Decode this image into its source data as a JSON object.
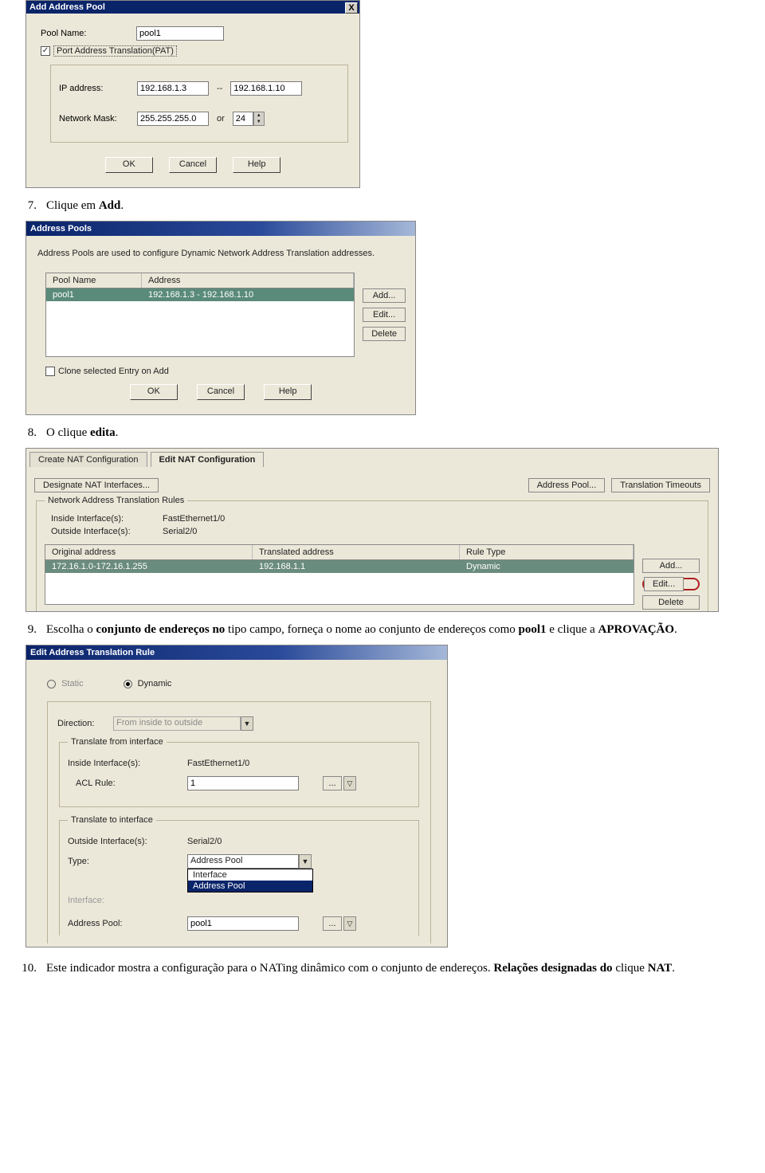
{
  "dlg1": {
    "title": "Add Address Pool",
    "labels": {
      "pool_name": "Pool Name:",
      "pat": "Port Address Translation(PAT)",
      "ip": "IP address:",
      "dash": "--",
      "mask": "Network Mask:",
      "or": "or"
    },
    "values": {
      "pool_name": "pool1",
      "ip_from": "192.168.1.3",
      "ip_to": "192.168.1.10",
      "mask": "255.255.255.0",
      "bits": "24",
      "pat_checked": "✓"
    },
    "buttons": {
      "ok": "OK",
      "cancel": "Cancel",
      "help": "Help"
    }
  },
  "step7": {
    "num": "7.",
    "text_a": "Clique em ",
    "text_b": "Add",
    "text_c": "."
  },
  "dlg2": {
    "title": "Address Pools",
    "intro": "Address Pools are used to configure Dynamic Network Address Translation addresses.",
    "cols": {
      "name": "Pool Name",
      "addr": "Address"
    },
    "row": {
      "name": "pool1",
      "addr": "192.168.1.3 - 192.168.1.10"
    },
    "buttons": {
      "add": "Add...",
      "edit": "Edit...",
      "del": "Delete",
      "ok": "OK",
      "cancel": "Cancel",
      "help": "Help"
    },
    "clone": "Clone selected Entry on Add"
  },
  "step8": {
    "num": "8.",
    "text_a": "O clique ",
    "text_b": "edita",
    "text_c": "."
  },
  "pnl3": {
    "tabs": {
      "create": "Create NAT Configuration",
      "edit": "Edit NAT Configuration"
    },
    "buttons": {
      "designate": "Designate NAT Interfaces...",
      "pool": "Address Pool...",
      "to": "Translation Timeouts",
      "add": "Add...",
      "edit": "Edit...",
      "del": "Delete"
    },
    "group": "Network Address Translation Rules",
    "inside_lbl": "Inside Interface(s):",
    "inside_val": "FastEthernet1/0",
    "outside_lbl": "Outside Interface(s):",
    "outside_val": "Serial2/0",
    "cols": {
      "orig": "Original address",
      "tran": "Translated address",
      "type": "Rule Type"
    },
    "row": {
      "orig": "172.16.1.0-172.16.1.255",
      "tran": "192.168.1.1",
      "type": "Dynamic"
    }
  },
  "step9": {
    "num": "9.",
    "t1": "Escolha o ",
    "t2": "conjunto de endereços no",
    "t3": " tipo campo, forneça o nome ao conjunto de endereços como ",
    "t4": "pool1",
    "t5": " e clique a ",
    "t6": "APROVAÇÃO",
    "t7": "."
  },
  "dlg4": {
    "title": "Edit Address Translation Rule",
    "radio": {
      "static": "Static",
      "dynamic": "Dynamic"
    },
    "dir_lbl": "Direction:",
    "dir_val": "From inside to outside",
    "grp_from": "Translate from interface",
    "inside_lbl": "Inside Interface(s):",
    "inside_val": "FastEthernet1/0",
    "acl_lbl": "ACL Rule:",
    "acl_val": "1",
    "aclbtn": "...",
    "grp_to": "Translate to interface",
    "outside_lbl": "Outside Interface(s):",
    "outside_val": "Serial2/0",
    "type_lbl": "Type:",
    "type_val": "Address Pool",
    "options": {
      "iface": "Interface",
      "pool": "Address Pool"
    },
    "iface_lbl": "Interface:",
    "pool_lbl": "Address Pool:",
    "pool_val": "pool1",
    "poolbtn": "..."
  },
  "step10": {
    "num": "10.",
    "t1": "Este indicador mostra a configuração para o NATing dinâmico com o conjunto de endereços. ",
    "t2": "Relações designadas do",
    "t3": " clique ",
    "t4": "NAT",
    "t5": "."
  }
}
